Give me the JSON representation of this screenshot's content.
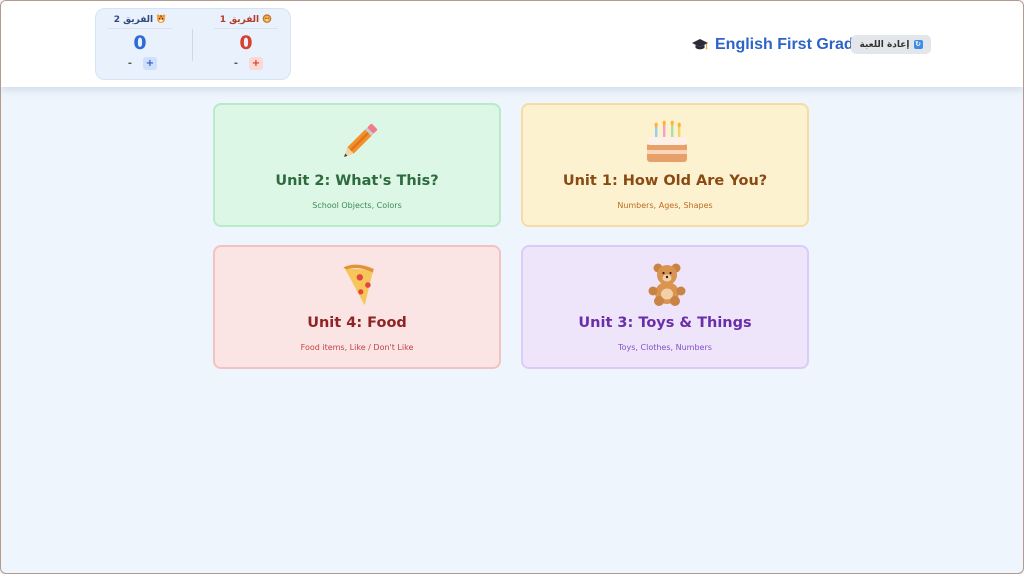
{
  "app": {
    "title": "English First Grade",
    "reset_label": "إعادة اللعبة",
    "title_icon": "graduation-cap-icon",
    "reset_icon": "restart-icon"
  },
  "scoreboard": {
    "team1": {
      "name": "الفريق 1",
      "icon": "lion-icon",
      "score": "0",
      "minus": "-",
      "plus": "+"
    },
    "team2": {
      "name": "الفريق 2",
      "icon": "tiger-icon",
      "score": "0",
      "minus": "-",
      "plus": "+"
    }
  },
  "units": [
    {
      "title": "Unit 1: How Old Are You?",
      "subtitle": "Numbers, Ages, Shapes",
      "icon": "birthday-cake-icon",
      "color": "#fdf2cf"
    },
    {
      "title": "Unit 2: What's This?",
      "subtitle": "School Objects, Colors",
      "icon": "pencil-icon",
      "color": "#dcf7e6"
    },
    {
      "title": "Unit 3: Toys & Things",
      "subtitle": "Toys, Clothes, Numbers",
      "icon": "teddy-bear-icon",
      "color": "#efe5fb"
    },
    {
      "title": "Unit 4: Food",
      "subtitle": "Food items, Like / Don't Like",
      "icon": "pizza-icon",
      "color": "#fbe4e4"
    }
  ]
}
